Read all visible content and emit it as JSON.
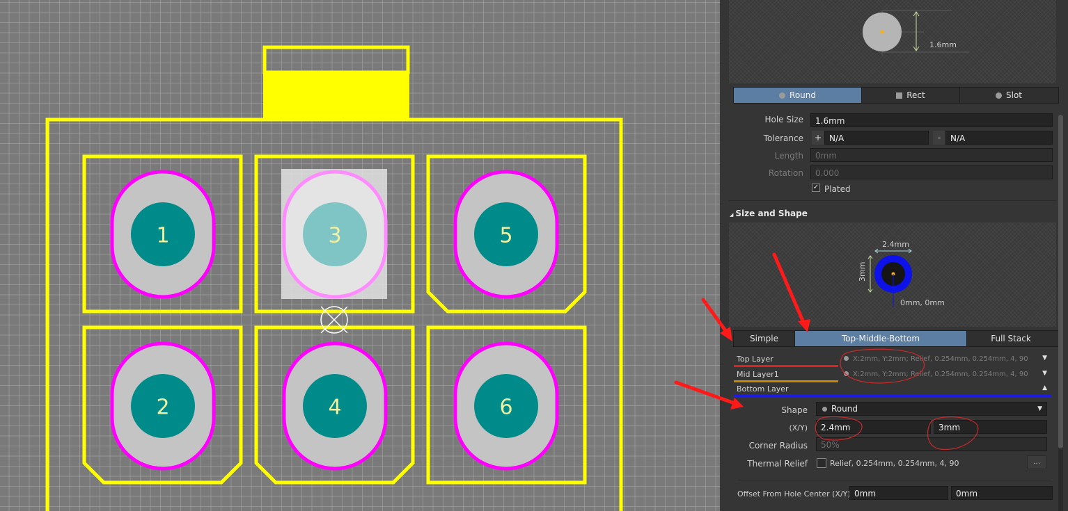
{
  "pads": [
    {
      "num": "1"
    },
    {
      "num": "3"
    },
    {
      "num": "5"
    },
    {
      "num": "2"
    },
    {
      "num": "4"
    },
    {
      "num": "6"
    }
  ],
  "colors": {
    "outline": "#ffff00",
    "pad_ring": "#ff00ff",
    "hole": "#008b8b",
    "pad_fill": "#c4c4c4",
    "panel_active": "#5b7ea2",
    "annotation": "#ff1a1a"
  },
  "hole_preview": {
    "dim_label": "1.6mm"
  },
  "hole_shape_tabs": [
    {
      "label": "Round",
      "icon": "circle-icon",
      "active": true
    },
    {
      "label": "Rect",
      "icon": "square-icon",
      "active": false
    },
    {
      "label": "Slot",
      "icon": "slot-icon",
      "active": false
    }
  ],
  "hole": {
    "hole_size_label": "Hole Size",
    "hole_size": "1.6mm",
    "tolerance_label": "Tolerance",
    "plus": "+",
    "tol_plus": "N/A",
    "minus": "-",
    "tol_minus": "N/A",
    "length_label": "Length",
    "length": "0mm",
    "rotation_label": "Rotation",
    "rotation": "0.000",
    "plated_label": "Plated",
    "plated": true
  },
  "size_shape": {
    "title": "Size and Shape",
    "preview_x": "2.4mm",
    "preview_y": "3mm",
    "preview_offset": "0mm, 0mm",
    "mode_tabs": [
      {
        "label": "Simple",
        "active": false
      },
      {
        "label": "Top-Middle-Bottom",
        "active": true
      },
      {
        "label": "Full Stack",
        "active": false
      }
    ],
    "layers": [
      {
        "name": "Top Layer",
        "desc": "X:2mm, Y:2mm; Relief, 0.254mm, 0.254mm, 4, 90",
        "color": "#e02020",
        "caret": "▼"
      },
      {
        "name": "Mid Layer1",
        "desc": "X:2mm, Y:2mm; Relief, 0.254mm, 0.254mm, 4, 90",
        "color": "#c98a00",
        "caret": "▼"
      },
      {
        "name": "Bottom Layer",
        "desc": "",
        "color": "#1c1ce0",
        "caret": "▲"
      }
    ],
    "shape_label": "Shape",
    "shape_value": "Round",
    "xy_label": "(X/Y)",
    "x": "2.4mm",
    "y": "3mm",
    "corner_label": "Corner Radius",
    "corner": "50%",
    "thermal_label": "Thermal Relief",
    "thermal_value": "Relief, 0.254mm, 0.254mm, 4, 90",
    "thermal_btn": "...",
    "offset_label": "Offset From Hole Center (X/Y)",
    "offset_x": "0mm",
    "offset_y": "0mm"
  }
}
